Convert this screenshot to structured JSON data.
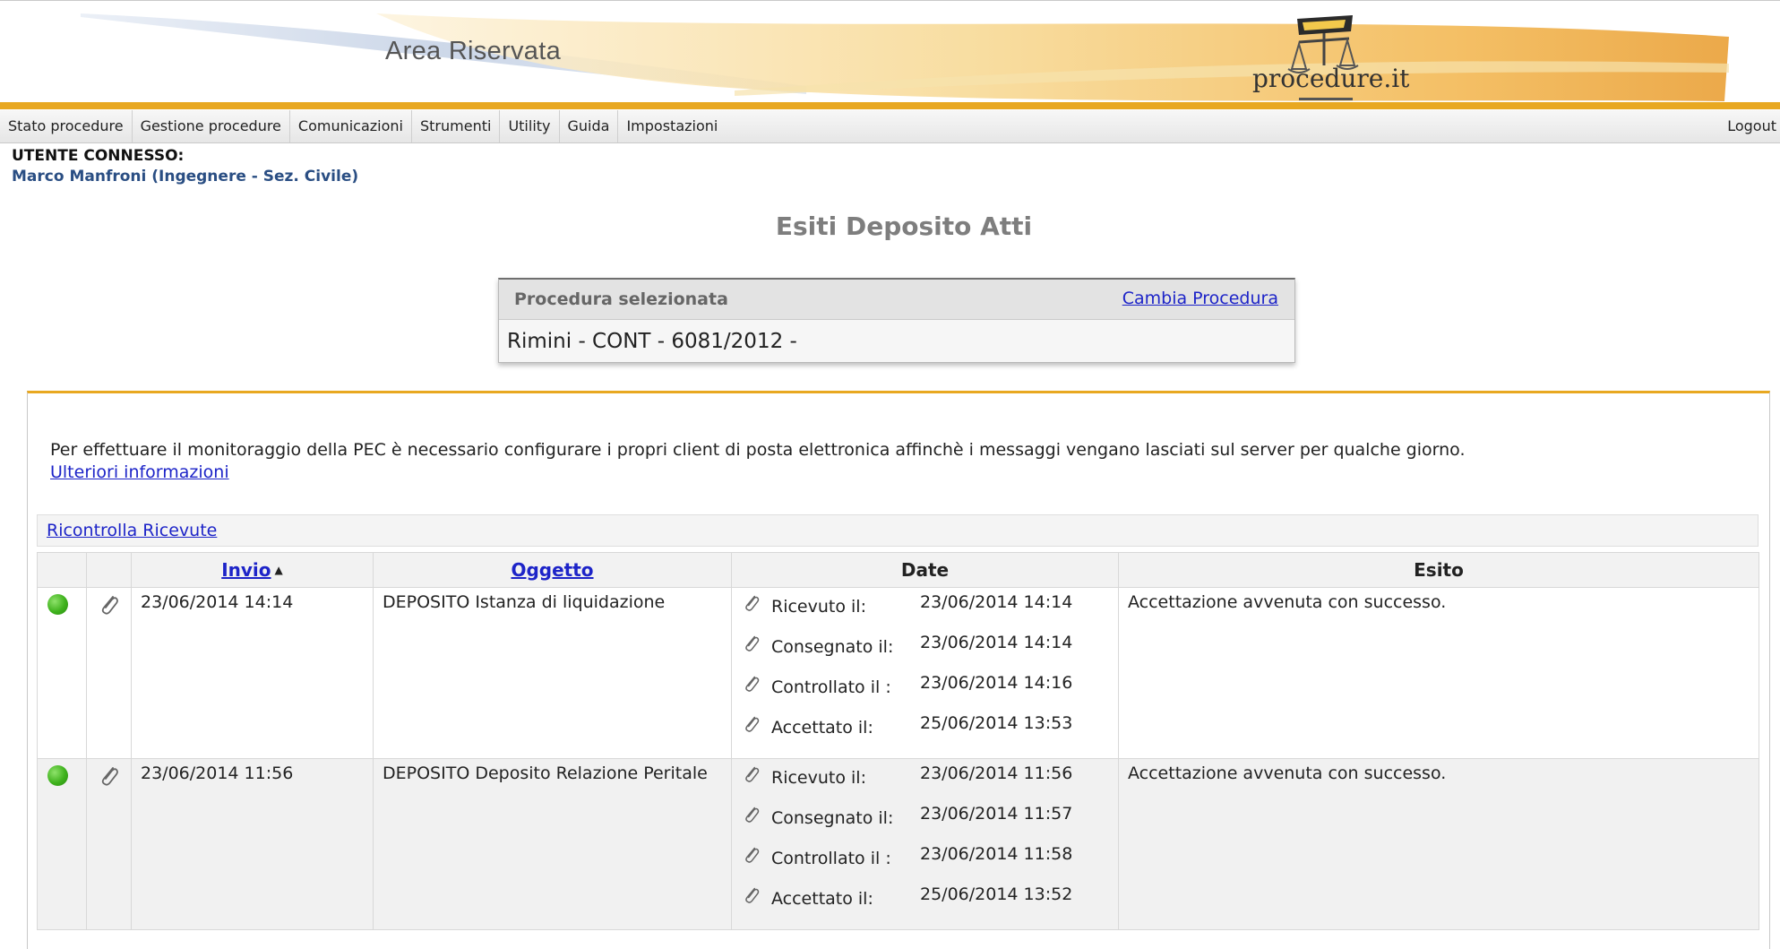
{
  "header": {
    "title": "Area Riservata",
    "logo_text": "procedure.it"
  },
  "menu": {
    "items": [
      "Stato procedure",
      "Gestione procedure",
      "Comunicazioni",
      "Strumenti",
      "Utility",
      "Guida",
      "Impostazioni"
    ],
    "logout": "Logout"
  },
  "user": {
    "label": "UTENTE CONNESSO:",
    "name": "Marco Manfroni (Ingegnere - Sez. Civile)"
  },
  "page_title": "Esiti Deposito Atti",
  "procedure": {
    "header_label": "Procedura selezionata",
    "change_link": "Cambia Procedura",
    "value": "Rimini - CONT - 6081/2012 -"
  },
  "notice": {
    "text": "Per effettuare il monitoraggio della PEC è necessario configurare i propri client di posta elettronica affinchè i messaggi vengano lasciati sul server per qualche giorno.",
    "link": "Ulteriori informazioni"
  },
  "recheck_link": "Ricontrolla Ricevute",
  "table": {
    "columns": {
      "invio": "Invio",
      "oggetto": "Oggetto",
      "date": "Date",
      "esito": "Esito"
    },
    "rows": [
      {
        "status_color": "#3fb21d",
        "invio": "23/06/2014 14:14",
        "oggetto": "DEPOSITO Istanza di liquidazione",
        "dates": [
          {
            "label": "Ricevuto il:",
            "value": "23/06/2014 14:14"
          },
          {
            "label": "Consegnato il:",
            "value": "23/06/2014 14:14"
          },
          {
            "label": "Controllato il :",
            "value": "23/06/2014 14:16"
          },
          {
            "label": "Accettato il:",
            "value": "25/06/2014 13:53"
          }
        ],
        "esito": "Accettazione avvenuta con successo."
      },
      {
        "status_color": "#3fb21d",
        "invio": "23/06/2014 11:56",
        "oggetto": "DEPOSITO Deposito Relazione Peritale",
        "dates": [
          {
            "label": "Ricevuto il:",
            "value": "23/06/2014 11:56"
          },
          {
            "label": "Consegnato il:",
            "value": "23/06/2014 11:57"
          },
          {
            "label": "Controllato il :",
            "value": "23/06/2014 11:58"
          },
          {
            "label": "Accettato il:",
            "value": "25/06/2014 13:52"
          }
        ],
        "esito": "Accettazione avvenuta con successo."
      }
    ]
  },
  "colors": {
    "accent_orange": "#e8a821",
    "link_blue": "#1d24c8",
    "user_blue": "#2a4e83"
  }
}
